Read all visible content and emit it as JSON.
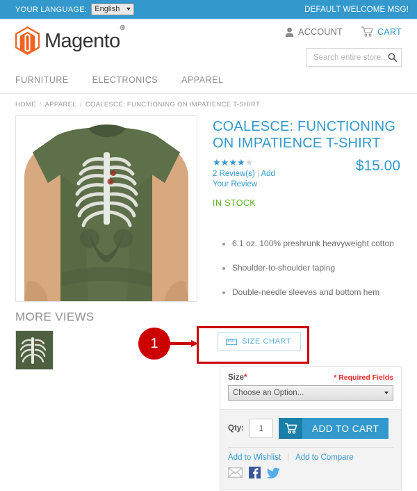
{
  "topbar": {
    "language_label": "YOUR LANGUAGE:",
    "language_value": "English",
    "welcome_message": "DEFAULT WELCOME MSG!"
  },
  "header": {
    "logo_text": "Magento",
    "logo_trademark": "®",
    "account_label": "ACCOUNT",
    "cart_label": "CART",
    "search_placeholder": "Search entire store..."
  },
  "nav": {
    "items": [
      {
        "label": "FURNITURE"
      },
      {
        "label": "ELECTRONICS"
      },
      {
        "label": "APPAREL"
      }
    ]
  },
  "breadcrumb": {
    "items": [
      {
        "label": "HOME"
      },
      {
        "label": "APPAREL"
      },
      {
        "label": "COALESCE: FUNCTIONING ON IMPATIENCE T-SHIRT"
      }
    ],
    "separator": "/"
  },
  "product": {
    "title": "COALESCE: FUNCTIONING ON IMPATIENCE T-SHIRT",
    "price": "$15.00",
    "rating_stars_filled": 4,
    "rating_stars_total": 5,
    "review_count_label": "2 Review(s)",
    "add_review_label": "Add Your Review",
    "review_separator": "|",
    "stock_status": "IN STOCK",
    "more_views_title": "MORE VIEWS",
    "features": [
      "6.1 oz. 100% preshrunk heavyweight cotton",
      "Shoulder-to-shoulder taping",
      "Double-needle sleeves and bottom hem"
    ],
    "size_chart_label": "SIZE CHART"
  },
  "cart_form": {
    "size_label": "Size",
    "required_marker": "*",
    "required_note": "* Required Fields",
    "size_selected_option": "Choose an Option...",
    "qty_label": "Qty:",
    "qty_value": "1",
    "add_to_cart_label": "ADD TO CART",
    "wishlist_label": "Add to Wishlist",
    "compare_label": "Add to Compare",
    "links_separator": "|"
  },
  "annotation": {
    "badge_number": "1"
  },
  "colors": {
    "accent_blue": "#3399cc",
    "topbar_blue": "#3399cc",
    "stock_green": "#5bb120",
    "required_red": "#e02b27",
    "annotation_red": "#cc0000",
    "logo_orange": "#f26322",
    "shirt_green": "#4a5d3a"
  }
}
